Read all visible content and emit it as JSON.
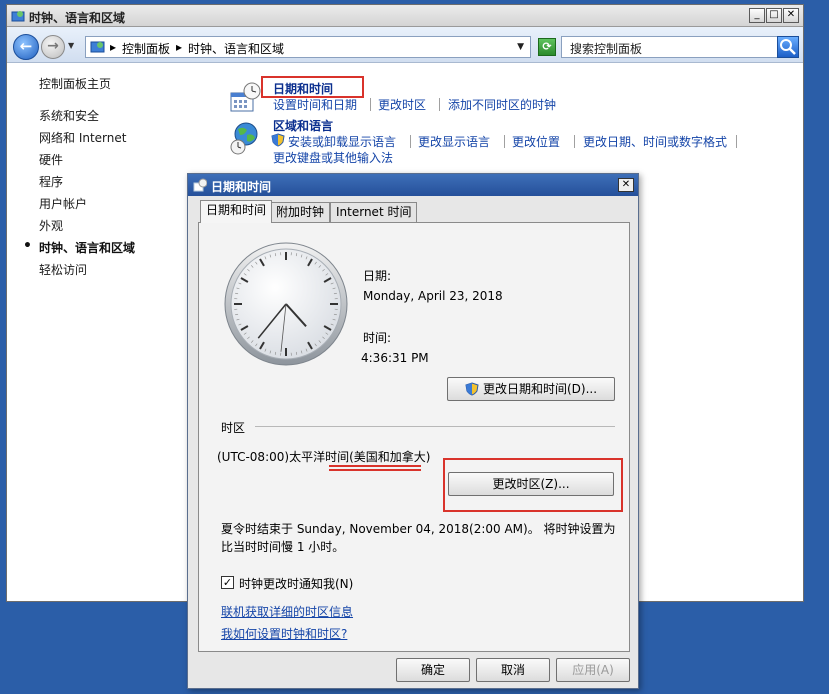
{
  "window": {
    "title": "时钟、语言和区域",
    "controls": {
      "minimize": "_",
      "maximize": "□",
      "close": "✕"
    },
    "breadcrumb": [
      "控制面板",
      "时钟、语言和区域"
    ],
    "search_placeholder": "搜索控制面板"
  },
  "sidebar": {
    "items": [
      {
        "label": "控制面板主页"
      },
      {
        "label": "系统和安全"
      },
      {
        "label": "网络和 Internet"
      },
      {
        "label": "硬件"
      },
      {
        "label": "程序"
      },
      {
        "label": "用户帐户"
      },
      {
        "label": "外观"
      },
      {
        "label": "时钟、语言和区域",
        "active": true
      },
      {
        "label": "轻松访问"
      }
    ]
  },
  "content": {
    "datetime": {
      "title": "日期和时间",
      "links": [
        "设置时间和日期",
        "更改时区",
        "添加不同时区的时钟"
      ]
    },
    "region": {
      "title": "区域和语言",
      "links": [
        "安装或卸载显示语言",
        "更改显示语言",
        "更改位置",
        "更改日期、时间或数字格式"
      ],
      "link2": "更改键盘或其他输入法"
    }
  },
  "dialog": {
    "title": "日期和时间",
    "close": "✕",
    "tabs": [
      "日期和时间",
      "附加时钟",
      "Internet 时间"
    ],
    "date_label": "日期:",
    "date_value": "Monday, April 23, 2018",
    "time_label": "时间:",
    "time_value": "4:36:31 PM",
    "change_datetime_button": "更改日期和时间(D)...",
    "timezone_label": "时区",
    "timezone_value": "(UTC-08:00)太平洋时间(美国和加拿大)",
    "change_timezone_button": "更改时区(Z)...",
    "dst_text_line1": "夏令时结束于 Sunday, November 04, 2018(2:00 AM)。 将时钟设置为",
    "dst_text_line2": "比当时时间慢 1 小时。",
    "notify_checkbox_label": "时钟更改时通知我(N)",
    "notify_checked": true,
    "link_online_info": "联机获取详细的时区信息",
    "link_howto": "我如何设置时钟和时区?",
    "ok_button": "确定",
    "cancel_button": "取消",
    "apply_button": "应用(A)"
  },
  "clock": {
    "hours": 4,
    "minutes": 36,
    "seconds": 31
  },
  "colors": {
    "highlight_red": "#d9332b",
    "link_blue": "#1545a8",
    "desktop": "#2b5ea8"
  }
}
